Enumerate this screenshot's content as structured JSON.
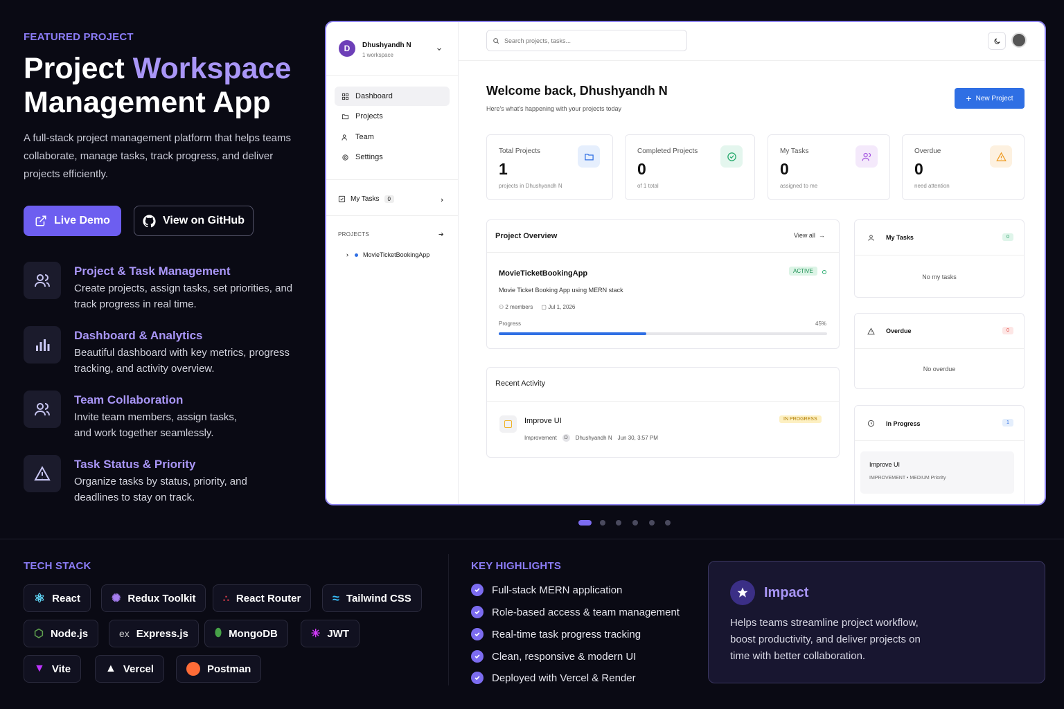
{
  "hero": {
    "tag": "FEATURED PROJECT",
    "title_1": "Project ",
    "title_2": "Workspace",
    "title_3": "Management App",
    "description": "A full-stack project management platform that helps teams collaborate, manage tasks, track progress, and deliver projects efficiently.",
    "live_demo": "Live Demo",
    "github": "View on GitHub"
  },
  "features": [
    {
      "title": "Project & Task Management",
      "text": "Create projects, assign tasks, set priorities, and track progress in real time.",
      "icon": "users-icon"
    },
    {
      "title": "Dashboard & Analytics",
      "text": "Beautiful dashboard with key metrics, progress tracking, and activity overview.",
      "icon": "bar-chart-icon"
    },
    {
      "title": "Team Collaboration",
      "text": "Invite team members, assign tasks, and work together seamlessly.",
      "icon": "users-icon"
    },
    {
      "title": "Task Status & Priority",
      "text": "Organize tasks by status, priority, and deadlines to stay on track.",
      "icon": "warning-icon"
    }
  ],
  "app": {
    "user": {
      "initial": "D",
      "name": "Dhushyandh N",
      "sub": "1 workspace"
    },
    "nav": [
      "Dashboard",
      "Projects",
      "Team",
      "Settings"
    ],
    "my_tasks": {
      "label": "My Tasks",
      "count": "0"
    },
    "projects_heading": "PROJECTS",
    "projects": [
      "MovieTicketBookingApp"
    ],
    "search_placeholder": "Search projects, tasks...",
    "welcome": "Welcome back, Dhushyandh N",
    "welcome_sub": "Here's what's happening with your projects today",
    "new_project": "New Project",
    "stats": [
      {
        "label": "Total Projects",
        "value": "1",
        "sub": "projects in Dhushyandh N",
        "color": "#2f6fe4",
        "bg": "#e6effd",
        "icon": "folder-icon"
      },
      {
        "label": "Completed Projects",
        "value": "0",
        "sub": "of 1 total",
        "color": "#22a86a",
        "bg": "#e4f6ee",
        "icon": "check-circle-icon"
      },
      {
        "label": "My Tasks",
        "value": "0",
        "sub": "assigned to me",
        "color": "#a455e0",
        "bg": "#f4e9fb",
        "icon": "users-icon"
      },
      {
        "label": "Overdue",
        "value": "0",
        "sub": "need attention",
        "color": "#ef9a1e",
        "bg": "#fdf1e0",
        "icon": "warning-icon"
      }
    ],
    "overview": {
      "title": "Project Overview",
      "view_all": "View all",
      "project": "MovieTicketBookingApp",
      "status": "ACTIVE",
      "desc": "Movie Ticket Booking App using MERN stack",
      "members": "2 members",
      "date": "Jul 1, 2026",
      "progress_label": "Progress",
      "progress_text": "45%",
      "progress": 0.45
    },
    "activity": {
      "title": "Recent Activity",
      "task": "Improve UI",
      "type": "Improvement",
      "user_initial": "D",
      "user": "Dhushyandh N",
      "time": "Jun 30, 3:57 PM",
      "status": "IN PROGRESS"
    },
    "panels": [
      {
        "title": "My Tasks",
        "count": "0",
        "empty": "No my tasks",
        "icon": "user-icon",
        "color": "#1d9a5e",
        "bg": "#dff5ea"
      },
      {
        "title": "Overdue",
        "count": "0",
        "empty": "No overdue",
        "icon": "warning-icon",
        "color": "#e0463f",
        "bg": "#fde6e5"
      },
      {
        "title": "In Progress",
        "count": "1",
        "icon": "clock-icon",
        "color": "#2f6fe4",
        "bg": "#e4eefc",
        "task": "Improve UI",
        "task_meta": "IMPROVEMENT • MEDIUM Priority"
      }
    ]
  },
  "tech": {
    "title": "TECH STACK",
    "items": [
      "React",
      "Redux Toolkit",
      "React Router",
      "Tailwind CSS",
      "Node.js",
      "Express.js",
      "MongoDB",
      "JWT",
      "Vite",
      "Vercel",
      "Postman"
    ]
  },
  "highlights": {
    "title": "KEY HIGHLIGHTS",
    "items": [
      "Full-stack MERN application",
      "Role-based access & team management",
      "Real-time task progress tracking",
      "Clean, responsive & modern UI",
      "Deployed with Vercel & Render"
    ]
  },
  "impact": {
    "title": "Impact",
    "text": "Helps teams streamline project workflow, boost productivity, and deliver projects on time with better collaboration."
  }
}
